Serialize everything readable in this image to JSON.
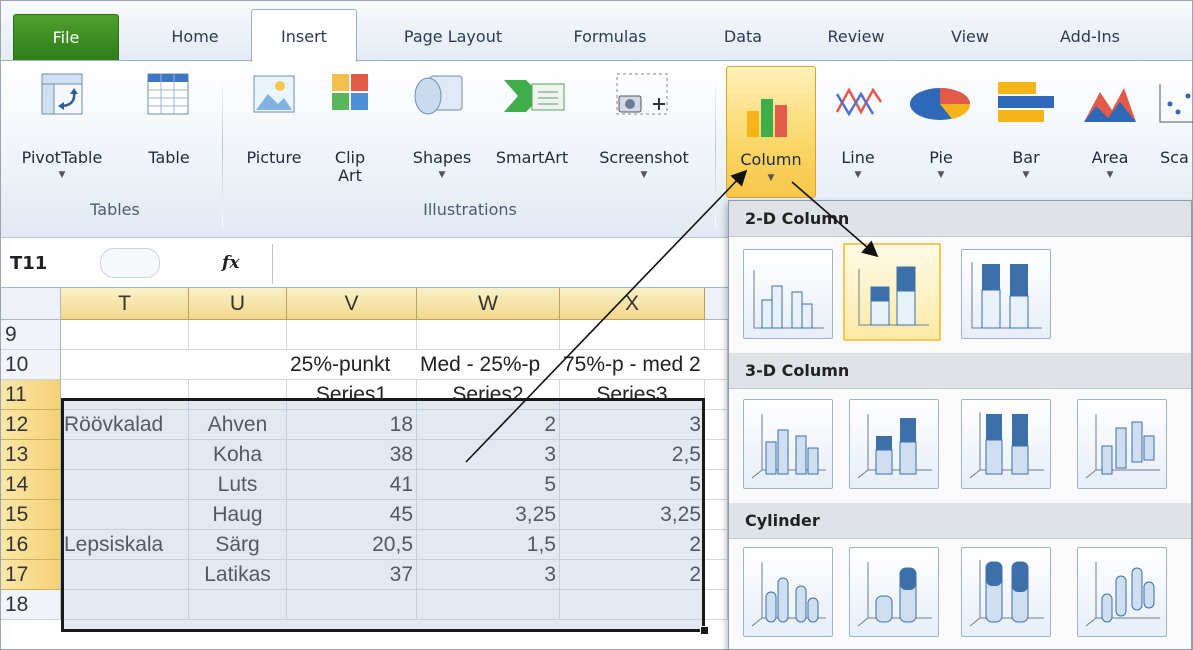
{
  "tabs": {
    "file": "File",
    "home": "Home",
    "insert": "Insert",
    "page_layout": "Page Layout",
    "formulas": "Formulas",
    "data": "Data",
    "review": "Review",
    "view": "View",
    "add_ins": "Add-Ins"
  },
  "ribbon": {
    "pivottable": "PivotTable",
    "table": "Table",
    "picture": "Picture",
    "clipart_1": "Clip",
    "clipart_2": "Art",
    "shapes": "Shapes",
    "smartart": "SmartArt",
    "screenshot": "Screenshot",
    "column": "Column",
    "line": "Line",
    "pie": "Pie",
    "bar": "Bar",
    "area": "Area",
    "scatter": "Sca",
    "groups": {
      "tables": "Tables",
      "illustrations": "Illustrations"
    }
  },
  "formula_bar": {
    "name_box": "T11",
    "fx": "fx",
    "formula": ""
  },
  "columns": [
    "T",
    "U",
    "V",
    "W",
    "X"
  ],
  "rows": [
    {
      "n": "9",
      "T": "",
      "U": "",
      "V": "",
      "W": "",
      "X": ""
    },
    {
      "n": "10",
      "T": "",
      "U": "",
      "V": "25%-punkt",
      "W": "Med - 25%-p",
      "X": "75%-p - med 2"
    },
    {
      "n": "11",
      "T": "",
      "U": "",
      "V": "Series1",
      "W": "Series2",
      "X": "Series3"
    },
    {
      "n": "12",
      "T": "Röövkalad",
      "U": "Ahven",
      "V": "18",
      "W": "2",
      "X": "3"
    },
    {
      "n": "13",
      "T": "",
      "U": "Koha",
      "V": "38",
      "W": "3",
      "X": "2,5"
    },
    {
      "n": "14",
      "T": "",
      "U": "Luts",
      "V": "41",
      "W": "5",
      "X": "5"
    },
    {
      "n": "15",
      "T": "",
      "U": "Haug",
      "V": "45",
      "W": "3,25",
      "X": "3,25"
    },
    {
      "n": "16",
      "T": "Lepsiskala",
      "U": "Särg",
      "V": "20,5",
      "W": "1,5",
      "X": "2"
    },
    {
      "n": "17",
      "T": "",
      "U": "Latikas",
      "V": "37",
      "W": "3",
      "X": "2"
    },
    {
      "n": "18",
      "T": "",
      "U": "",
      "V": "",
      "W": "",
      "X": ""
    }
  ],
  "dropdown": {
    "section_2d": "2-D Column",
    "section_3d": "3-D Column",
    "section_cyl": "Cylinder"
  },
  "colors": {
    "accent_selected": "#f2c94c",
    "file_tab": "#3a8f24"
  }
}
